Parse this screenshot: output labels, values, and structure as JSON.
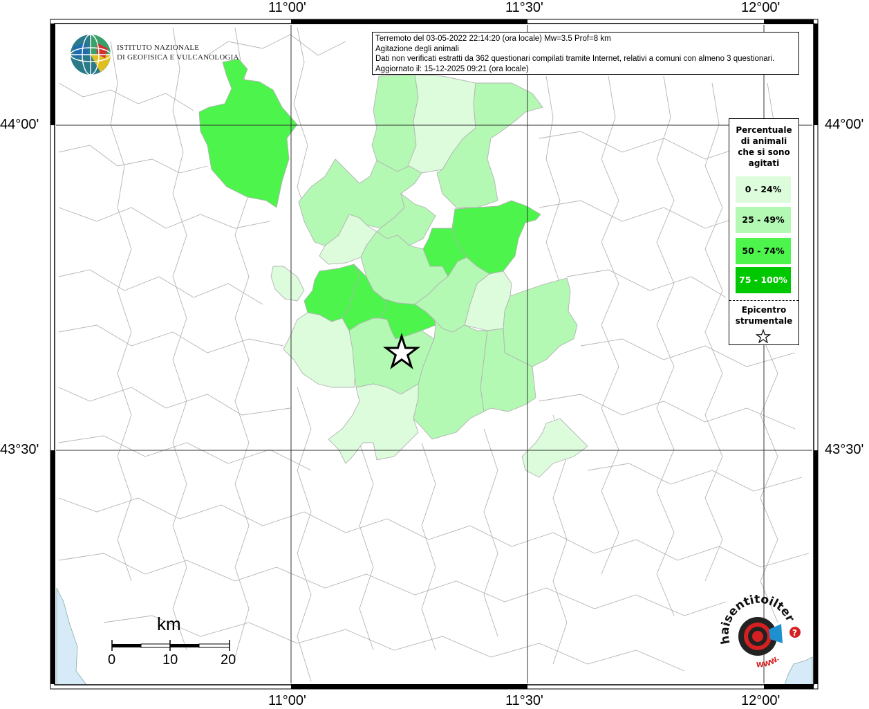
{
  "info": {
    "line1": "Terremoto del 03-05-2022 22:14:20 (ora locale) Mw=3.5 Prof=8 km",
    "line2": "Agitazione degli animali",
    "line3": "Dati non verificati estratti da 362 questionari compilati tramite Internet, relativi a comuni con almeno 3 questionari.",
    "line4": "Aggiornato il: 15-12-2025 09:21 (ora locale)"
  },
  "coords": {
    "lon_left": "11°00'",
    "lon_mid": "11°30'",
    "lon_right": "12°00'",
    "lat_top": "44°00'",
    "lat_bottom": "43°30'"
  },
  "legend": {
    "title": [
      "Percentuale",
      "di animali",
      "che si sono",
      "agitati"
    ],
    "classes": [
      {
        "label": "0 - 24%",
        "color": "#dcfcdc"
      },
      {
        "label": "25 - 49%",
        "color": "#b3f8b3"
      },
      {
        "label": "50 - 74%",
        "color": "#4cf44c"
      },
      {
        "label": "75 - 100%",
        "color": "#00c800"
      }
    ],
    "epicenter_title": [
      "Epicentro",
      "strumentale"
    ],
    "epicenter_icon": "star-icon"
  },
  "scalebar": {
    "unit": "km",
    "ticks": [
      "0",
      "10",
      "20"
    ]
  },
  "logos": {
    "ingv_line1": "ISTITUTO NAZIONALE",
    "ingv_line2": "DI GEOFISICA E VULCANOLOGIA",
    "hst_text": "haisentitoilterremoto.it",
    "hst_url": "WWW."
  },
  "colors": {
    "sea": "#d6eaf8",
    "border": "#b0b0b0",
    "grid": "#000000"
  }
}
